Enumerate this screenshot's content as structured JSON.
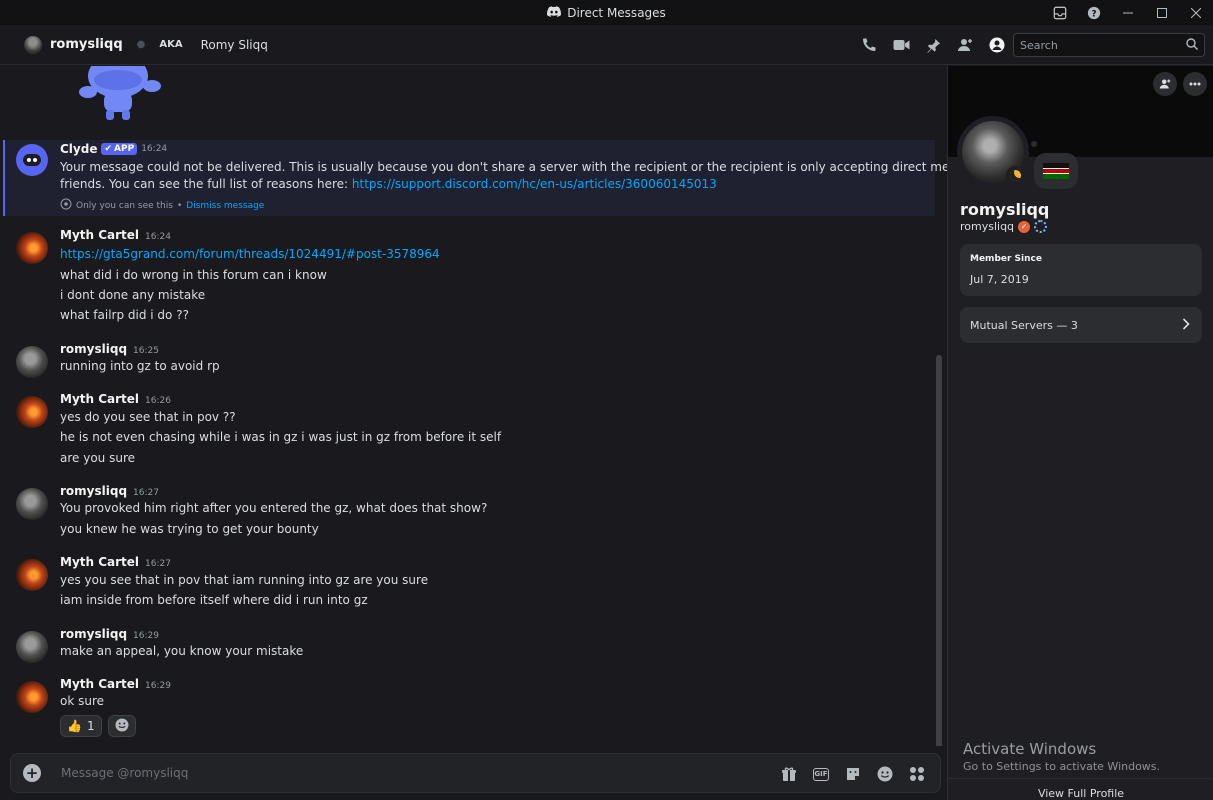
{
  "window": {
    "title": "Direct Messages"
  },
  "header": {
    "username": "romysliqq",
    "aka_label": "AKA",
    "aka_name": "Romy Sliqq",
    "search_placeholder": "Search"
  },
  "clyde": {
    "name": "Clyde",
    "badge": "APP",
    "time": "16:24",
    "text_line1": "Your message could not be delivered. This is usually because you don't share a server with the recipient or the recipient is only accepting direct messages from",
    "text_line2_prefix": "friends. You can see the full list of reasons here: ",
    "link": "https://support.discord.com/hc/en-us/articles/360060145013",
    "only_you": "Only you can see this",
    "separator": "•",
    "dismiss": "Dismiss message"
  },
  "messages": [
    {
      "author": "Myth Cartel",
      "time": "16:24",
      "lines": [
        "https://gta5grand.com/forum/threads/1024491/#post-3578964",
        "what did i do wrong in this forum can i know",
        "i dont done any mistake",
        "what failrp did i do  ??"
      ]
    },
    {
      "author": "romysliqq",
      "time": "16:25",
      "lines": [
        "running into gz to avoid rp"
      ]
    },
    {
      "author": "Myth Cartel",
      "time": "16:26",
      "lines": [
        "yes do you see that in pov ??",
        "he is not even chasing while i was in gz i was just in gz from before it self",
        "are you sure"
      ]
    },
    {
      "author": "romysliqq",
      "time": "16:27",
      "lines": [
        "You provoked him right after you entered the gz, what does that show?",
        "you knew he was trying to get your bounty"
      ]
    },
    {
      "author": "Myth Cartel",
      "time": "16:27",
      "lines": [
        "yes you see that in pov that iam running into gz are you sure",
        "iam inside from before itself where did i run into gz"
      ]
    },
    {
      "author": "romysliqq",
      "time": "16:29",
      "lines": [
        "make an appeal, you know your mistake"
      ]
    },
    {
      "author": "Myth Cartel",
      "time": "16:29",
      "lines": [
        "ok sure"
      ],
      "reaction_count": "1"
    }
  ],
  "composer": {
    "placeholder": "Message @romysliqq"
  },
  "profile": {
    "display_name": "romysliqq",
    "username": "romysliqq",
    "member_since_label": "Member Since",
    "member_since": "Jul 7, 2019",
    "mutual_servers": "Mutual Servers — 3",
    "view_full_profile": "View Full Profile"
  },
  "watermark": {
    "line1": "Activate Windows",
    "line2": "Go to Settings to activate Windows."
  },
  "colors": {
    "accent": "#5865f2",
    "link": "#00a8fc",
    "background": "#1a1a1e"
  }
}
